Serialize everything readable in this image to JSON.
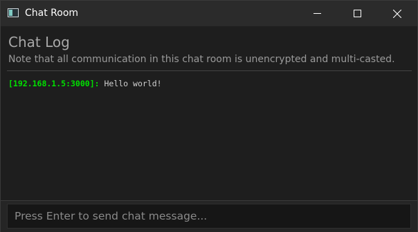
{
  "window": {
    "title": "Chat Room",
    "app_icon": "window-app-icon",
    "controls": {
      "minimize_icon": "minimize-icon",
      "maximize_icon": "maximize-icon",
      "close_icon": "close-icon"
    }
  },
  "chat_log": {
    "title": "Chat Log",
    "note": "Note that all communication in this chat room is unencrypted and multi-casted.",
    "messages": [
      {
        "sender": "[192.168.1.5:3000]:",
        "text": " Hello world!"
      }
    ]
  },
  "input": {
    "placeholder": "Press Enter to send chat message...",
    "value": ""
  },
  "colors": {
    "sender": "#00e000",
    "background": "#1e1e1e",
    "titlebar": "#2b2b2b"
  }
}
